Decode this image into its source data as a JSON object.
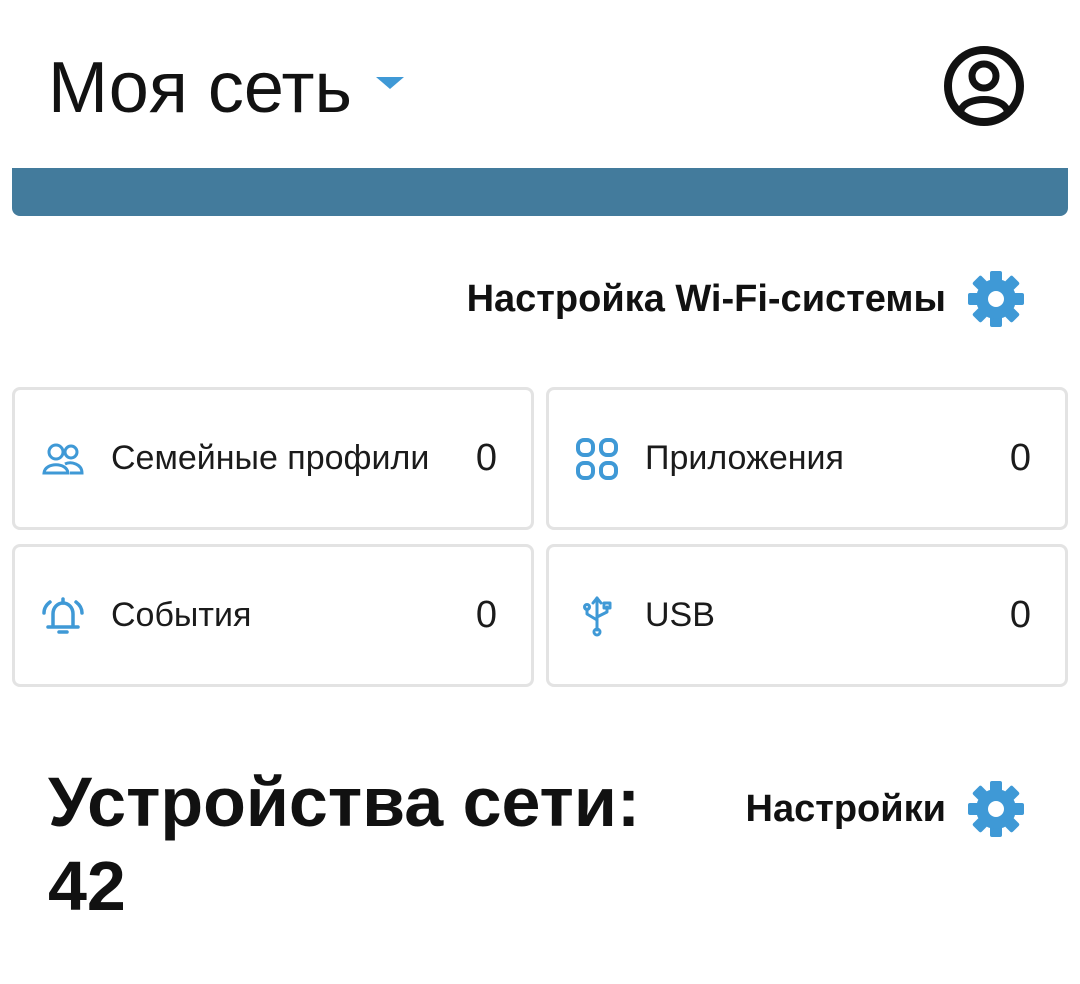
{
  "header": {
    "network_name": "Моя сеть",
    "dropdown_icon": "caret-down-icon",
    "account_icon": "account-circle-icon"
  },
  "status_banner": {
    "color": "#437b9c"
  },
  "wifi_settings": {
    "label": "Настройка Wi-Fi-системы",
    "icon": "gear-icon"
  },
  "tiles": [
    {
      "label": "Семейные профили",
      "count": "0",
      "icon": "family-profiles-icon"
    },
    {
      "label": "Приложения",
      "count": "0",
      "icon": "apps-grid-icon"
    },
    {
      "label": "События",
      "count": "0",
      "icon": "bell-icon"
    },
    {
      "label": "USB",
      "count": "0",
      "icon": "usb-icon"
    }
  ],
  "devices": {
    "title": "Устройства сети:",
    "count": "42",
    "settings_label": "Настройки",
    "settings_icon": "gear-icon"
  },
  "colors": {
    "accent": "#3f99d6",
    "banner": "#437b9c",
    "text": "#111111",
    "tile_border": "#e3e3e3"
  }
}
